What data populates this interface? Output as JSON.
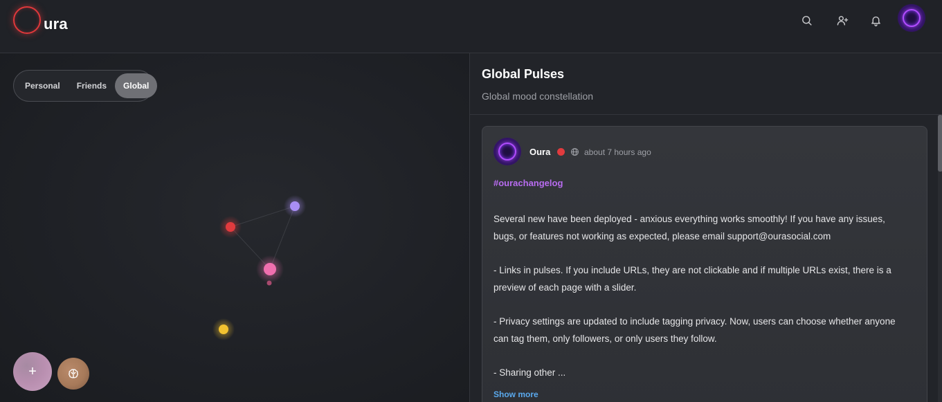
{
  "app": {
    "logo_text": "ura",
    "logo_ring_color": "#e0383b"
  },
  "header": {
    "icons": [
      "search-icon",
      "add-friend-icon",
      "bell-icon",
      "user-avatar"
    ]
  },
  "map": {
    "scope_tabs": [
      {
        "label": "Personal",
        "active": false
      },
      {
        "label": "Friends",
        "active": false
      },
      {
        "label": "Global",
        "active": true
      }
    ],
    "mood_nodes": [
      {
        "mood": "red",
        "color": "#e03b3e"
      },
      {
        "mood": "purple",
        "color": "#a98ef5"
      },
      {
        "mood": "pink",
        "color": "#f06fae"
      },
      {
        "mood": "yellow",
        "color": "#f2c230"
      }
    ],
    "add_button_label": "+",
    "brain_icon": "brain-icon"
  },
  "panel": {
    "title": "Global Pulses",
    "subtitle": "Global mood constellation"
  },
  "post": {
    "author": "Oura",
    "mood_color": "#e03b3e",
    "visibility_icon": "globe-icon",
    "time": "about 7 hours ago",
    "tag": "#ourachangelog",
    "paragraphs": [
      "Several new have been deployed - anxious everything works smoothly!  If you have any issues, bugs, or features not working as expected, please email support@ourasocial.com",
      "- Links in pulses.  If you include URLs, they are not clickable and if multiple URLs exist, there is a preview of each page with a slider.",
      "- Privacy settings are updated to include tagging privacy.  Now, users can choose whether anyone can tag them, only followers, or only users they follow.",
      "- Sharing other ..."
    ],
    "show_more": "Show more"
  }
}
